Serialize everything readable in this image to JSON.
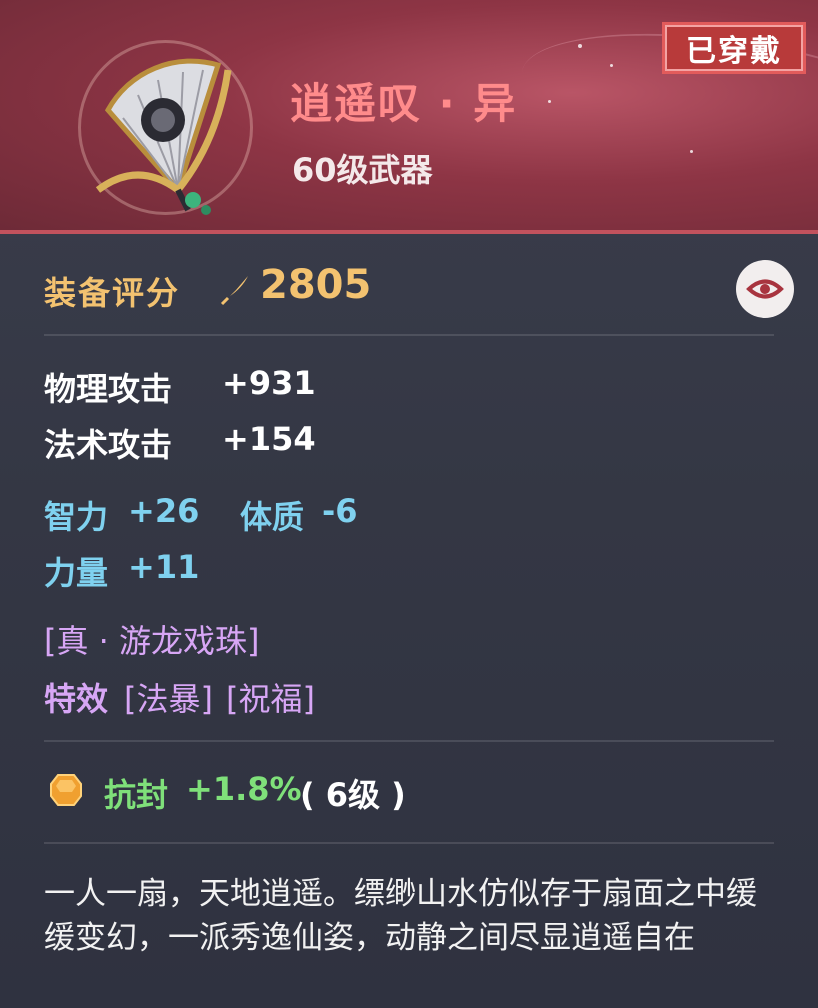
{
  "header": {
    "title": "逍遥叹 · 异",
    "subtitle": "60级武器",
    "status_badge": "已穿戴"
  },
  "item_icon": "fan-weapon-icon",
  "score": {
    "label": "装备评分",
    "icon": "quill-icon",
    "value": "2805"
  },
  "view_button": "eye-icon",
  "base_stats": [
    {
      "name": "物理攻击",
      "value": "+931"
    },
    {
      "name": "法术攻击",
      "value": "+154"
    }
  ],
  "extra_stats": [
    {
      "name": "智力",
      "value": "+26"
    },
    {
      "name": "体质",
      "value": "-6"
    },
    {
      "name": "力量",
      "value": "+11"
    }
  ],
  "special": {
    "skill": "[真 · 游龙戏珠]",
    "effect_label": "特效",
    "effect_1": "[法暴]",
    "effect_2": "[祝福]"
  },
  "gem": {
    "icon": "amber-gem-icon",
    "name": "抗封",
    "value": "+1.8%",
    "level": "( 6级 )"
  },
  "description": "一人一扇，天地逍遥。缥缈山水仿似存于扇面之中缓缓变幻，一派秀逸仙姿，动静之间尽显逍遥自在",
  "colors": {
    "title": "#ff8b8b",
    "score": "#f3c270",
    "attribute": "#7fd1ef",
    "special": "#d7a6f5",
    "gem_stat": "#7fe07a",
    "badge": "#b83a3a"
  }
}
